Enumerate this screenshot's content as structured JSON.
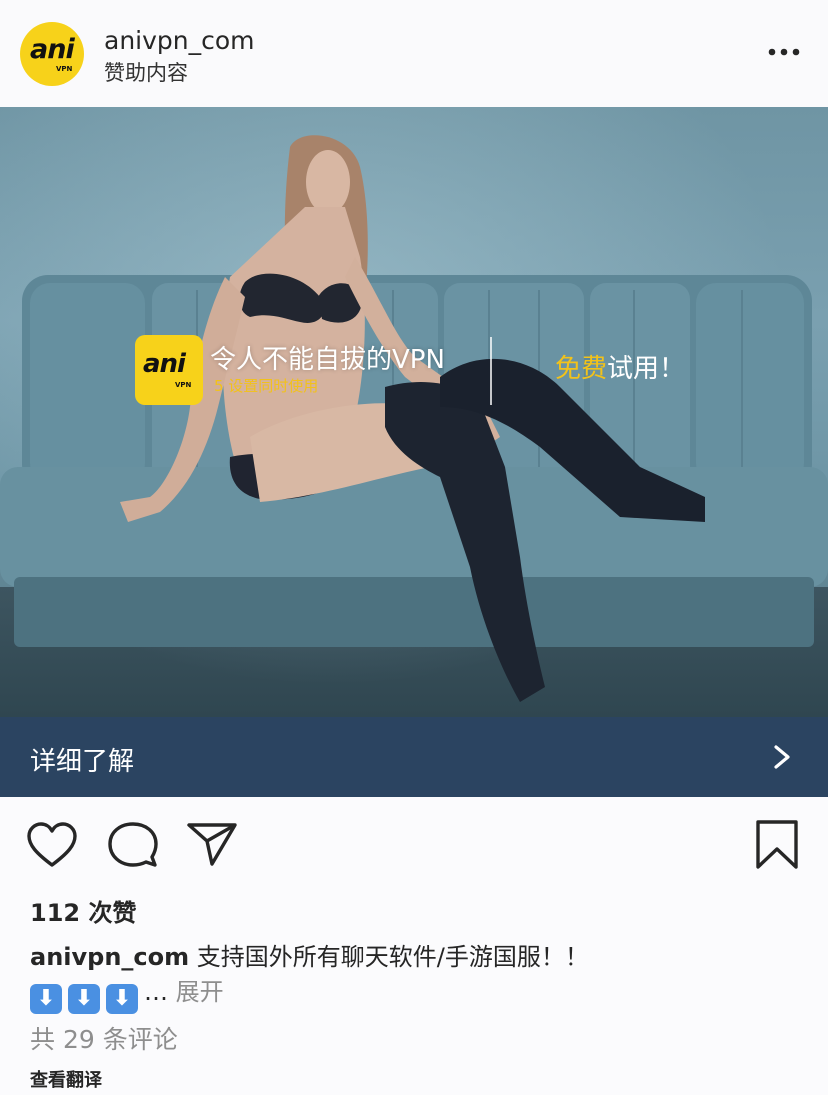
{
  "post": {
    "username": "anivpn_com",
    "sponsored_label": "赞助内容",
    "avatar_logo": "ani",
    "avatar_sub": "VPN"
  },
  "ad": {
    "logo_text": "ani",
    "logo_sub": "VPN",
    "headline": "令人不能自拔的VPN",
    "subline": "5 设置同时使用",
    "cta_highlight": "免费",
    "cta_rest": "试用！"
  },
  "learn_more": {
    "label": "详细了解"
  },
  "icons": {
    "more": "more-icon",
    "chevron": "chevron-right-icon",
    "like": "heart-icon",
    "comment": "comment-icon",
    "share": "share-icon",
    "save": "bookmark-icon"
  },
  "likes_text": "112 次赞",
  "caption": {
    "username": "anivpn_com",
    "text": "支持国外所有聊天软件/手游国服！！",
    "ellipsis": "…",
    "more_label": "展开",
    "emoji_arrows": [
      "⬇",
      "⬇",
      "⬇"
    ]
  },
  "comments_text": "共 29 条评论",
  "translate_label": "查看翻译",
  "colors": {
    "brand_yellow": "#f7d21a",
    "cta_bar": "#2b4461",
    "muted_text": "#8e8e8e"
  }
}
